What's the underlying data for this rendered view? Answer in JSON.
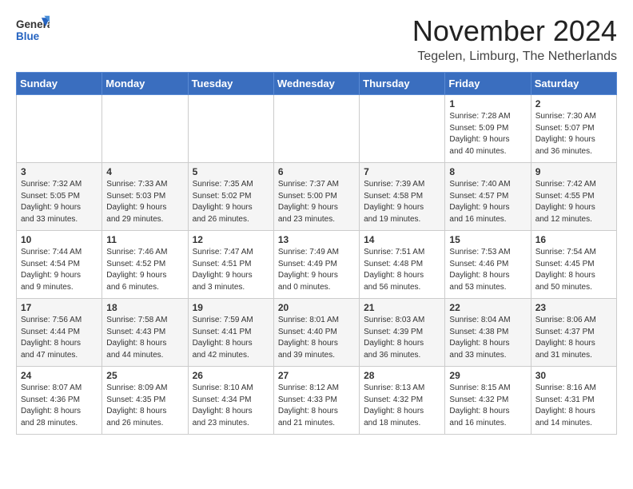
{
  "header": {
    "logo": {
      "general": "General",
      "blue": "Blue"
    },
    "title": "November 2024",
    "location": "Tegelen, Limburg, The Netherlands"
  },
  "calendar": {
    "days_of_week": [
      "Sunday",
      "Monday",
      "Tuesday",
      "Wednesday",
      "Thursday",
      "Friday",
      "Saturday"
    ],
    "weeks": [
      {
        "id": "week1",
        "days": [
          {
            "num": "",
            "info": ""
          },
          {
            "num": "",
            "info": ""
          },
          {
            "num": "",
            "info": ""
          },
          {
            "num": "",
            "info": ""
          },
          {
            "num": "",
            "info": ""
          },
          {
            "num": "1",
            "info": "Sunrise: 7:28 AM\nSunset: 5:09 PM\nDaylight: 9 hours\nand 40 minutes."
          },
          {
            "num": "2",
            "info": "Sunrise: 7:30 AM\nSunset: 5:07 PM\nDaylight: 9 hours\nand 36 minutes."
          }
        ]
      },
      {
        "id": "week2",
        "days": [
          {
            "num": "3",
            "info": "Sunrise: 7:32 AM\nSunset: 5:05 PM\nDaylight: 9 hours\nand 33 minutes."
          },
          {
            "num": "4",
            "info": "Sunrise: 7:33 AM\nSunset: 5:03 PM\nDaylight: 9 hours\nand 29 minutes."
          },
          {
            "num": "5",
            "info": "Sunrise: 7:35 AM\nSunset: 5:02 PM\nDaylight: 9 hours\nand 26 minutes."
          },
          {
            "num": "6",
            "info": "Sunrise: 7:37 AM\nSunset: 5:00 PM\nDaylight: 9 hours\nand 23 minutes."
          },
          {
            "num": "7",
            "info": "Sunrise: 7:39 AM\nSunset: 4:58 PM\nDaylight: 9 hours\nand 19 minutes."
          },
          {
            "num": "8",
            "info": "Sunrise: 7:40 AM\nSunset: 4:57 PM\nDaylight: 9 hours\nand 16 minutes."
          },
          {
            "num": "9",
            "info": "Sunrise: 7:42 AM\nSunset: 4:55 PM\nDaylight: 9 hours\nand 12 minutes."
          }
        ]
      },
      {
        "id": "week3",
        "days": [
          {
            "num": "10",
            "info": "Sunrise: 7:44 AM\nSunset: 4:54 PM\nDaylight: 9 hours\nand 9 minutes."
          },
          {
            "num": "11",
            "info": "Sunrise: 7:46 AM\nSunset: 4:52 PM\nDaylight: 9 hours\nand 6 minutes."
          },
          {
            "num": "12",
            "info": "Sunrise: 7:47 AM\nSunset: 4:51 PM\nDaylight: 9 hours\nand 3 minutes."
          },
          {
            "num": "13",
            "info": "Sunrise: 7:49 AM\nSunset: 4:49 PM\nDaylight: 9 hours\nand 0 minutes."
          },
          {
            "num": "14",
            "info": "Sunrise: 7:51 AM\nSunset: 4:48 PM\nDaylight: 8 hours\nand 56 minutes."
          },
          {
            "num": "15",
            "info": "Sunrise: 7:53 AM\nSunset: 4:46 PM\nDaylight: 8 hours\nand 53 minutes."
          },
          {
            "num": "16",
            "info": "Sunrise: 7:54 AM\nSunset: 4:45 PM\nDaylight: 8 hours\nand 50 minutes."
          }
        ]
      },
      {
        "id": "week4",
        "days": [
          {
            "num": "17",
            "info": "Sunrise: 7:56 AM\nSunset: 4:44 PM\nDaylight: 8 hours\nand 47 minutes."
          },
          {
            "num": "18",
            "info": "Sunrise: 7:58 AM\nSunset: 4:43 PM\nDaylight: 8 hours\nand 44 minutes."
          },
          {
            "num": "19",
            "info": "Sunrise: 7:59 AM\nSunset: 4:41 PM\nDaylight: 8 hours\nand 42 minutes."
          },
          {
            "num": "20",
            "info": "Sunrise: 8:01 AM\nSunset: 4:40 PM\nDaylight: 8 hours\nand 39 minutes."
          },
          {
            "num": "21",
            "info": "Sunrise: 8:03 AM\nSunset: 4:39 PM\nDaylight: 8 hours\nand 36 minutes."
          },
          {
            "num": "22",
            "info": "Sunrise: 8:04 AM\nSunset: 4:38 PM\nDaylight: 8 hours\nand 33 minutes."
          },
          {
            "num": "23",
            "info": "Sunrise: 8:06 AM\nSunset: 4:37 PM\nDaylight: 8 hours\nand 31 minutes."
          }
        ]
      },
      {
        "id": "week5",
        "days": [
          {
            "num": "24",
            "info": "Sunrise: 8:07 AM\nSunset: 4:36 PM\nDaylight: 8 hours\nand 28 minutes."
          },
          {
            "num": "25",
            "info": "Sunrise: 8:09 AM\nSunset: 4:35 PM\nDaylight: 8 hours\nand 26 minutes."
          },
          {
            "num": "26",
            "info": "Sunrise: 8:10 AM\nSunset: 4:34 PM\nDaylight: 8 hours\nand 23 minutes."
          },
          {
            "num": "27",
            "info": "Sunrise: 8:12 AM\nSunset: 4:33 PM\nDaylight: 8 hours\nand 21 minutes."
          },
          {
            "num": "28",
            "info": "Sunrise: 8:13 AM\nSunset: 4:32 PM\nDaylight: 8 hours\nand 18 minutes."
          },
          {
            "num": "29",
            "info": "Sunrise: 8:15 AM\nSunset: 4:32 PM\nDaylight: 8 hours\nand 16 minutes."
          },
          {
            "num": "30",
            "info": "Sunrise: 8:16 AM\nSunset: 4:31 PM\nDaylight: 8 hours\nand 14 minutes."
          }
        ]
      }
    ]
  }
}
